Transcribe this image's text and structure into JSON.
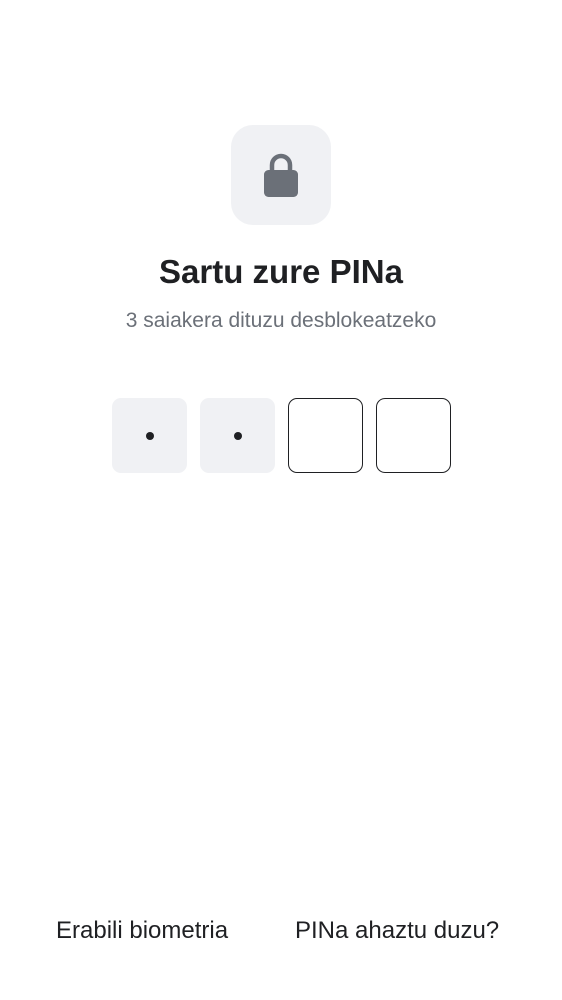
{
  "lock_icon": {
    "name": "lock-icon",
    "color": "#6b7078",
    "tile_color": "#f0f1f4"
  },
  "title": "Sartu zure PINa",
  "subtitle": "3 saiakera dituzu desblokeatzeko",
  "pin": {
    "length": 4,
    "entered_count": 2,
    "cells": [
      {
        "state": "filled",
        "symbol": "•"
      },
      {
        "state": "filled",
        "symbol": "•"
      },
      {
        "state": "empty",
        "symbol": ""
      },
      {
        "state": "empty",
        "symbol": ""
      }
    ]
  },
  "actions": {
    "use_biometrics": "Erabili biometria",
    "forgot_pin": "PINa ahaztu duzu?"
  },
  "colors": {
    "text_primary": "#1f2023",
    "text_secondary": "#6b7078",
    "filled_cell": "#f0f1f4",
    "background": "#ffffff"
  }
}
